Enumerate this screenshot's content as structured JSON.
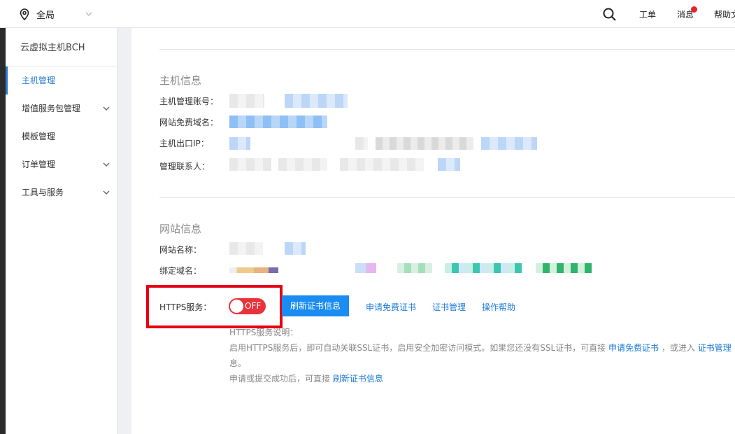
{
  "topbar": {
    "location": "全局",
    "ticket": "工单",
    "messages": "消息",
    "help": "帮助文"
  },
  "sidebar": {
    "title": "云虚拟主机BCH",
    "items": [
      {
        "label": "主机管理",
        "active": true,
        "expandable": false
      },
      {
        "label": "增值服务包管理",
        "expandable": true
      },
      {
        "label": "模板管理",
        "expandable": false
      },
      {
        "label": "订单管理",
        "expandable": true
      },
      {
        "label": "工具与服务",
        "expandable": true
      }
    ]
  },
  "host_info": {
    "title": "主机信息",
    "labels": {
      "account": "主机管理账号：",
      "free_domain": "网站免费域名：",
      "exit_ip": "主机出口IP：",
      "contact": "管理联系人："
    }
  },
  "site_info": {
    "title": "网站信息",
    "labels": {
      "site_name": "网站名称：",
      "bound_domain": "绑定域名："
    }
  },
  "https": {
    "label": "HTTPS服务：",
    "toggle_state": "OFF",
    "refresh_button": "刷新证书信息",
    "link_apply": "申请免费证书",
    "link_manage": "证书管理",
    "link_help": "操作帮助",
    "note_title": "HTTPS服务说明：",
    "note_line1_a": "启用HTTPS服务后，即可自动关联SSL证书，启用安全加密访问模式。如果您还没有SSL证书，可直接",
    "note_line1_link1": "申请免费证书",
    "note_line1_b": "，或进入",
    "note_line1_link2": "证书管理",
    "note_line2": "息。",
    "note_line3_a": "申请或提交成功后，可直接",
    "note_line3_link": "刷新证书信息"
  },
  "colors": {
    "accent": "#1b8cf2",
    "highlight": "#e60012",
    "toggle_off": "#e8333b"
  }
}
